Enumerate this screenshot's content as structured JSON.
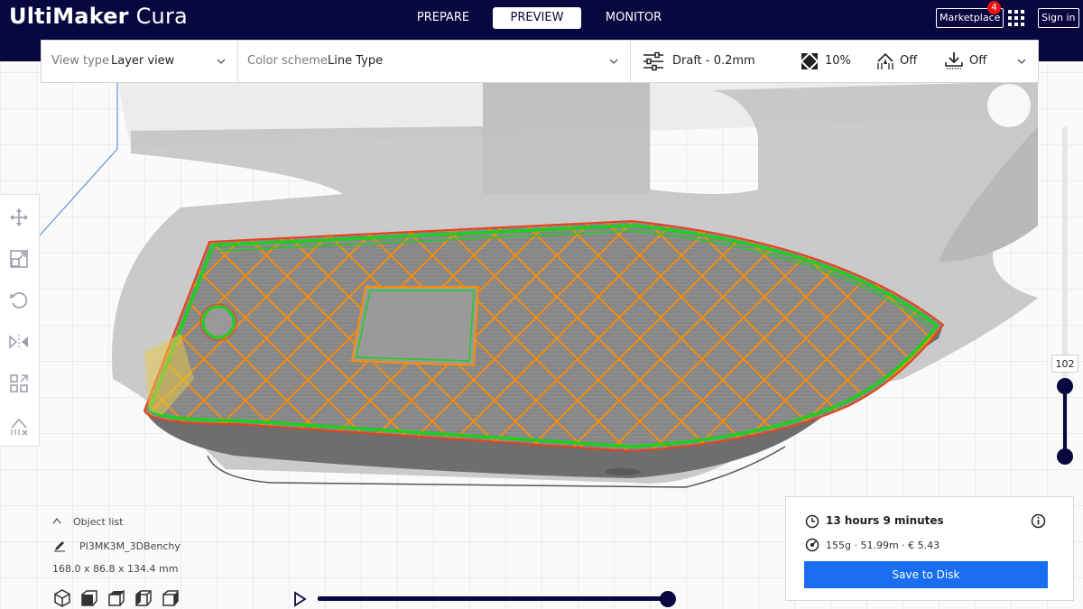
{
  "app": {
    "logo_bold": "UltiMaker",
    "logo_light": "Cura"
  },
  "stages": [
    {
      "label": "PREPARE",
      "active": false
    },
    {
      "label": "PREVIEW",
      "active": true
    },
    {
      "label": "MONITOR",
      "active": false
    }
  ],
  "header": {
    "marketplace_label": "Marketplace",
    "marketplace_badge": "4",
    "signin_label": "Sign in"
  },
  "view_settings": {
    "view_type_label": "View type",
    "view_type_value": "Layer view",
    "color_scheme_label": "Color scheme",
    "color_scheme_value": "Line Type"
  },
  "print_settings": {
    "profile": "Draft - 0.2mm",
    "infill": "10%",
    "support": "Off",
    "adhesion": "Off"
  },
  "layer_slider": {
    "current_layer": "102"
  },
  "object_list": {
    "header": "Object list",
    "object_name": "PI3MK3M_3DBenchy",
    "dimensions": "168.0 x 86.8 x 134.4 mm"
  },
  "print_info": {
    "time": "13 hours 9 minutes",
    "material": "155g · 51.99m · € 5.43",
    "save_label": "Save to Disk"
  },
  "colors": {
    "header_bg": "#08073f",
    "accent_blue": "#196ef0",
    "wall_outer": "#e8421a",
    "wall_inner": "#1ecf1e",
    "infill": "#ff8c00",
    "model_gray": "#808080"
  }
}
